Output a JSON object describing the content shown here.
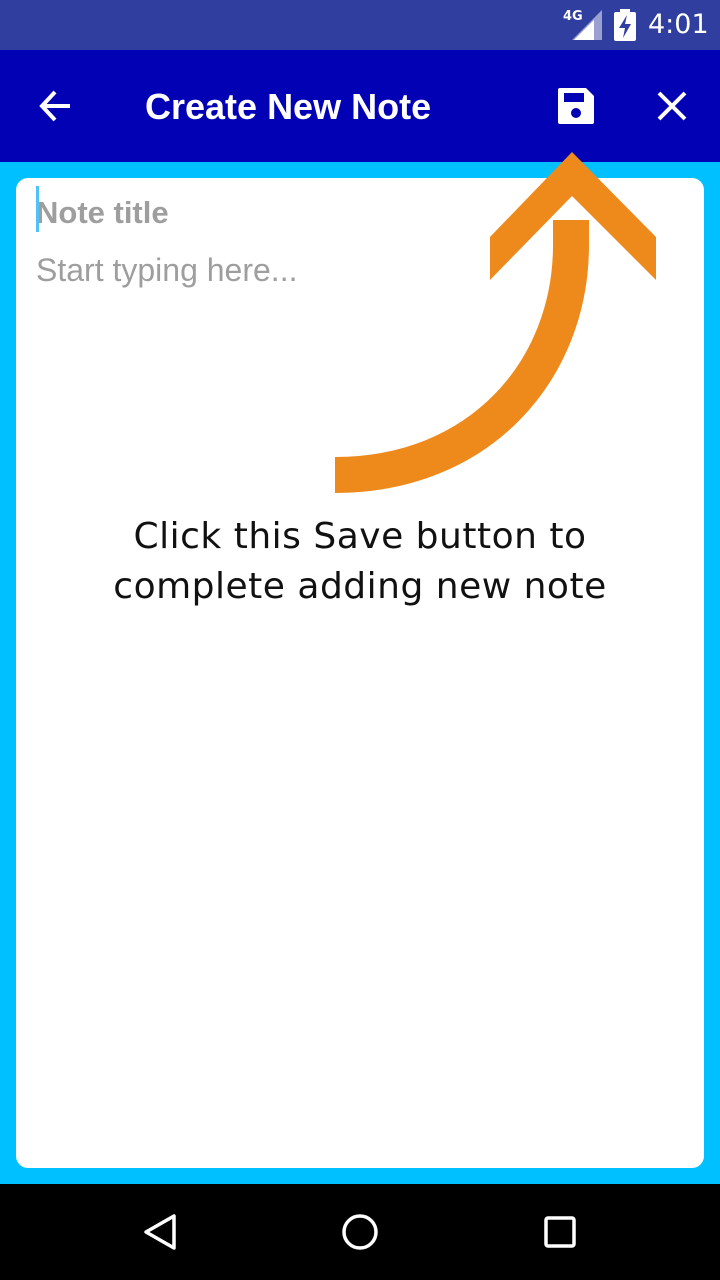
{
  "status_bar": {
    "network_label": "4G",
    "time": "4:01"
  },
  "app_bar": {
    "title": "Create New Note",
    "back_icon": "arrow-left-icon",
    "save_icon": "floppy-disk-icon",
    "close_icon": "close-icon"
  },
  "editor": {
    "title_placeholder": "Note title",
    "title_value": "",
    "body_placeholder": "Start typing here...",
    "body_value": ""
  },
  "tutorial": {
    "hint_line1": "Click this Save button to",
    "hint_line2": "complete adding new note",
    "arrow_color": "#ee8a1b"
  },
  "nav_bar": {
    "back_icon": "triangle-back-icon",
    "home_icon": "circle-home-icon",
    "recents_icon": "square-recents-icon"
  },
  "colors": {
    "status_bar": "#303f9f",
    "app_bar": "#0202b4",
    "background": "#00c0ff",
    "card": "#ffffff"
  }
}
